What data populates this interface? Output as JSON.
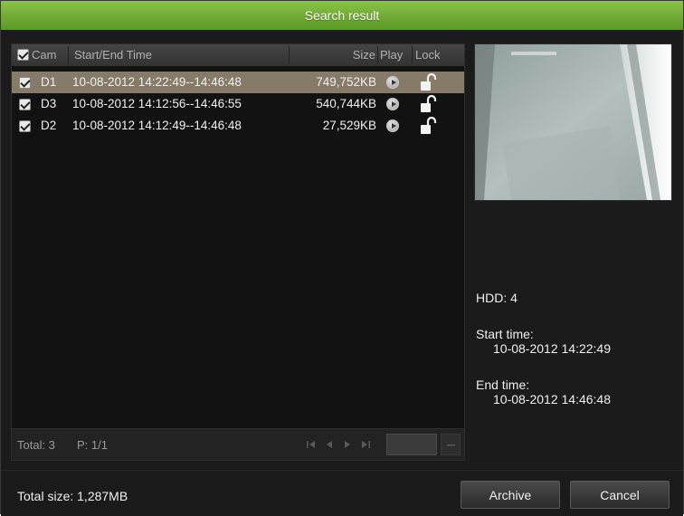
{
  "dialog": {
    "title": "Search result"
  },
  "list": {
    "headers": {
      "cam": "Cam",
      "time": "Start/End Time",
      "size": "Size",
      "play": "Play",
      "lock": "Lock"
    },
    "rows": [
      {
        "cam": "D1",
        "time": "10-08-2012 14:22:49--14:46:48",
        "size": "749,752KB",
        "checked": true,
        "selected": true,
        "locked": false
      },
      {
        "cam": "D3",
        "time": "10-08-2012 14:12:56--14:46:55",
        "size": "540,744KB",
        "checked": true,
        "selected": false,
        "locked": false
      },
      {
        "cam": "D2",
        "time": "10-08-2012 14:12:49--14:46:48",
        "size": "27,529KB",
        "checked": true,
        "selected": false,
        "locked": false
      }
    ],
    "footer": {
      "total": "Total: 3",
      "page": "P: 1/1"
    }
  },
  "details": {
    "hdd": "HDD: 4",
    "start_label": "Start time:",
    "start_value": "10-08-2012 14:22:49",
    "end_label": "End time:",
    "end_value": "10-08-2012 14:46:48"
  },
  "bottom": {
    "total_size": "Total size: 1,287MB",
    "archive_label": "Archive",
    "cancel_label": "Cancel"
  },
  "colors": {
    "title_green": "#6ea832",
    "selected_row": "#867a68",
    "panel_bg": "#1b1b1b"
  }
}
